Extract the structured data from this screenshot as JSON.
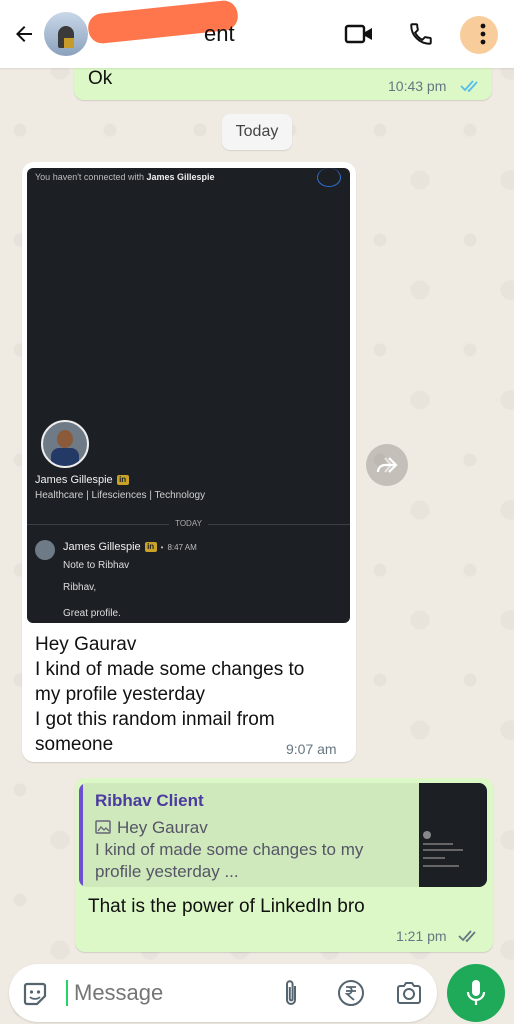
{
  "colors": {
    "outgoing": "#dcf8c6",
    "incoming": "#ffffff",
    "accent": "#25d366",
    "read_ticks": "#53bdeb"
  },
  "header": {
    "contact_name_visible": "ent",
    "icons": [
      "back-arrow-icon",
      "video-call-icon",
      "voice-call-icon",
      "more-options-icon"
    ]
  },
  "messages": {
    "ok": {
      "text": "Ok",
      "time": "10:43 pm",
      "status": "read"
    },
    "date_separator": "Today",
    "incoming": {
      "screenshot": {
        "top_note_prefix": "You haven't connected with",
        "top_note_name": "James Gillespie",
        "profile_name": "James Gillespie",
        "badge": "in",
        "headline": "Healthcare | Lifesciences | Technology",
        "divider_label": "TODAY",
        "sender_name": "James Gillespie",
        "sender_time": "8:47 AM",
        "subject": "Note to Ribhav",
        "line1": "Ribhav,",
        "line2": "Great profile."
      },
      "text_lines": [
        "Hey Gaurav",
        "I kind of made some changes to",
        "my profile yesterday",
        "I got this random inmail from",
        "someone"
      ],
      "time": "9:07 am"
    },
    "reply": {
      "quoted_name": "Ribhav Client",
      "quoted_line1": "Hey Gaurav",
      "quoted_line2": "I kind of made some changes to my",
      "quoted_line3": "profile yesterday ...",
      "text": "That is the power of LinkedIn bro",
      "time": "1:21 pm",
      "status": "delivered"
    }
  },
  "composer": {
    "placeholder": "Message",
    "icons": [
      "sticker-icon",
      "attach-icon",
      "rupee-payment-icon",
      "camera-icon",
      "mic-icon"
    ]
  }
}
